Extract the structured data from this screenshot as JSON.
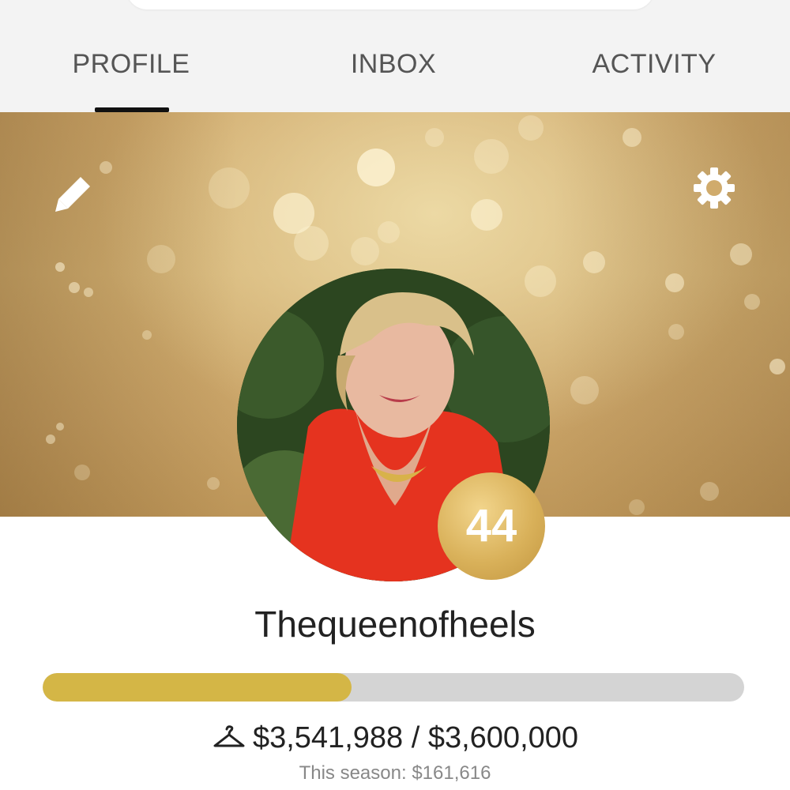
{
  "tabs": [
    {
      "label": "PROFILE",
      "active": true
    },
    {
      "label": "INBOX",
      "active": false
    },
    {
      "label": "ACTIVITY",
      "active": false
    }
  ],
  "banner": {
    "edit_icon": "pencil-icon",
    "settings_icon": "gear-icon"
  },
  "profile": {
    "username": "Thequeenofheels",
    "level": "44",
    "avatar": "profile-photo"
  },
  "sales": {
    "current": "$3,541,988",
    "separator": "/",
    "goal": "$3,600,000",
    "icon": "hanger-icon",
    "season_text": "This season: $161,616",
    "progress_fraction": 0.44
  },
  "colors": {
    "accent_gold": "#d4b646",
    "track_gray": "#d4d4d4",
    "tab_underline": "#111111",
    "tab_bar_bg": "#f3f3f3"
  }
}
